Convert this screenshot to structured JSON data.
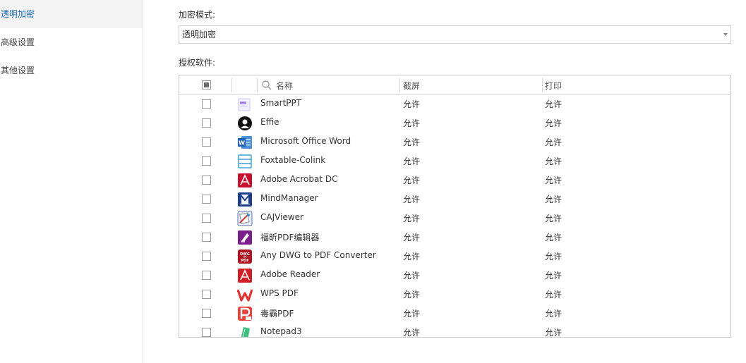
{
  "sidebar": {
    "items": [
      {
        "label": "透明加密",
        "active": true
      },
      {
        "label": "高级设置",
        "active": false
      },
      {
        "label": "其他设置",
        "active": false
      }
    ]
  },
  "main": {
    "mode_label": "加密模式:",
    "mode_value": "透明加密",
    "software_label": "授权软件:",
    "table": {
      "columns": [
        "名称",
        "截屏",
        "打印"
      ],
      "rows": [
        {
          "name": "SmartPPT",
          "icon": "smartppt-icon",
          "screenshot": "允许",
          "print": "允许"
        },
        {
          "name": "Effie",
          "icon": "effie-icon",
          "screenshot": "允许",
          "print": "允许"
        },
        {
          "name": "Microsoft Office Word",
          "icon": "word-icon",
          "screenshot": "允许",
          "print": "允许"
        },
        {
          "name": "Foxtable-Colink",
          "icon": "foxtable-icon",
          "screenshot": "允许",
          "print": "允许"
        },
        {
          "name": "Adobe Acrobat DC",
          "icon": "acrobat-icon",
          "screenshot": "允许",
          "print": "允许"
        },
        {
          "name": "MindManager",
          "icon": "mindmanager-icon",
          "screenshot": "允许",
          "print": "允许"
        },
        {
          "name": "CAJViewer",
          "icon": "cajviewer-icon",
          "screenshot": "允许",
          "print": "允许"
        },
        {
          "name": "福昕PDF编辑器",
          "icon": "foxit-pdf-icon",
          "screenshot": "允许",
          "print": "允许"
        },
        {
          "name": "Any DWG to PDF Converter",
          "icon": "dwg-pdf-icon",
          "screenshot": "允许",
          "print": "允许"
        },
        {
          "name": "Adobe Reader",
          "icon": "adobe-reader-icon",
          "screenshot": "允许",
          "print": "允许"
        },
        {
          "name": "WPS PDF",
          "icon": "wps-pdf-icon",
          "screenshot": "允许",
          "print": "允许"
        },
        {
          "name": "毒霸PDF",
          "icon": "duba-pdf-icon",
          "screenshot": "允许",
          "print": "允许"
        },
        {
          "name": "Notepad3",
          "icon": "notepad3-icon",
          "screenshot": "允许",
          "print": "允许"
        }
      ]
    }
  },
  "colors": {
    "accent": "#1e6fc2",
    "border": "#c9c9c9"
  }
}
